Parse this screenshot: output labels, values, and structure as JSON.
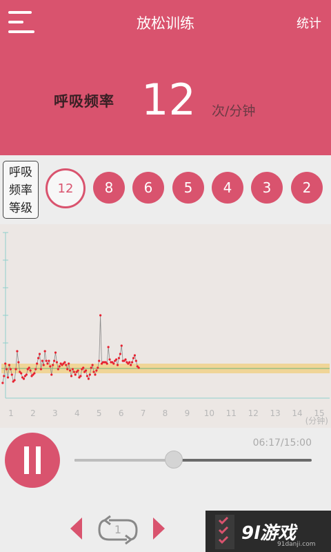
{
  "header": {
    "title": "放松训练",
    "stats_label": "统计",
    "rate_label": "呼吸频率",
    "rate_value": "12",
    "rate_unit": "次/分钟"
  },
  "levels": {
    "label": "呼吸频率等级",
    "options": [
      "12",
      "8",
      "6",
      "5",
      "4",
      "3",
      "2"
    ],
    "selected": "12"
  },
  "chart_data": {
    "type": "line",
    "x_ticks": [
      "1",
      "2",
      "3",
      "4",
      "5",
      "6",
      "7",
      "8",
      "9",
      "10",
      "11",
      "12",
      "13",
      "14",
      "15"
    ],
    "xlabel": "(分钟)",
    "xlim": [
      0.6,
      15.2
    ],
    "ylim": [
      0,
      12
    ],
    "target_band": [
      1.7,
      2.4
    ],
    "target_line": 2.05,
    "grid": false,
    "x": [
      0.62,
      0.68,
      0.74,
      0.8,
      0.86,
      0.92,
      0.98,
      1.04,
      1.1,
      1.16,
      1.22,
      1.28,
      1.34,
      1.4,
      1.46,
      1.52,
      1.58,
      1.64,
      1.7,
      1.76,
      1.82,
      1.88,
      1.94,
      2.0,
      2.06,
      2.12,
      2.18,
      2.24,
      2.3,
      2.36,
      2.42,
      2.48,
      2.54,
      2.6,
      2.66,
      2.72,
      2.78,
      2.84,
      2.9,
      2.96,
      3.02,
      3.08,
      3.14,
      3.2,
      3.26,
      3.32,
      3.38,
      3.44,
      3.5,
      3.56,
      3.62,
      3.68,
      3.74,
      3.8,
      3.86,
      3.92,
      3.98,
      4.04,
      4.1,
      4.16,
      4.22,
      4.28,
      4.34,
      4.4,
      4.46,
      4.52,
      4.58,
      4.64,
      4.7,
      4.76,
      4.82,
      4.88,
      4.94,
      5.0,
      5.06,
      5.12,
      5.18,
      5.24,
      5.3,
      5.36,
      5.42,
      5.48,
      5.54,
      5.6,
      5.66,
      5.72,
      5.78,
      5.84,
      5.9,
      5.96,
      6.02,
      6.08,
      6.14,
      6.2,
      6.26,
      6.32,
      6.38,
      6.44,
      6.5,
      6.56,
      6.62,
      6.68,
      6.74,
      6.8
    ],
    "y": [
      1.0,
      1.5,
      2.4,
      2.0,
      1.4,
      2.3,
      2.0,
      1.6,
      1.1,
      1.2,
      2.0,
      3.3,
      2.5,
      1.8,
      1.7,
      1.4,
      1.3,
      1.5,
      1.6,
      2.0,
      2.1,
      1.9,
      1.5,
      1.6,
      1.7,
      2.0,
      2.4,
      2.8,
      3.1,
      2.0,
      2.6,
      2.3,
      3.3,
      2.6,
      2.4,
      2.6,
      2.2,
      1.6,
      2.3,
      2.6,
      3.2,
      2.5,
      2.0,
      2.2,
      2.4,
      2.3,
      2.4,
      2.5,
      2.3,
      2.0,
      2.4,
      1.9,
      1.5,
      2.0,
      1.8,
      1.6,
      1.8,
      1.9,
      1.4,
      1.5,
      2.0,
      2.1,
      1.8,
      1.9,
      1.5,
      1.3,
      1.6,
      2.1,
      2.3,
      1.8,
      1.6,
      1.9,
      2.1,
      2.6,
      5.9,
      2.4,
      2.5,
      2.5,
      2.5,
      2.4,
      3.6,
      2.7,
      2.5,
      2.5,
      2.4,
      2.6,
      2.7,
      2.3,
      2.8,
      3.1,
      3.7,
      2.6,
      2.6,
      2.7,
      2.5,
      2.4,
      2.5,
      2.3,
      2.5,
      2.8,
      3.0,
      2.6,
      2.2,
      2.1
    ]
  },
  "player": {
    "time_display": "06:17/15:00",
    "progress": 0.419,
    "cycle_count": "1"
  },
  "watermark": {
    "text": "9l游戏",
    "url": "91danji.com"
  },
  "colors": {
    "accent": "#d9536e",
    "band": "#f1d189",
    "line": "#8a8a8a",
    "dot": "#e8202f"
  }
}
